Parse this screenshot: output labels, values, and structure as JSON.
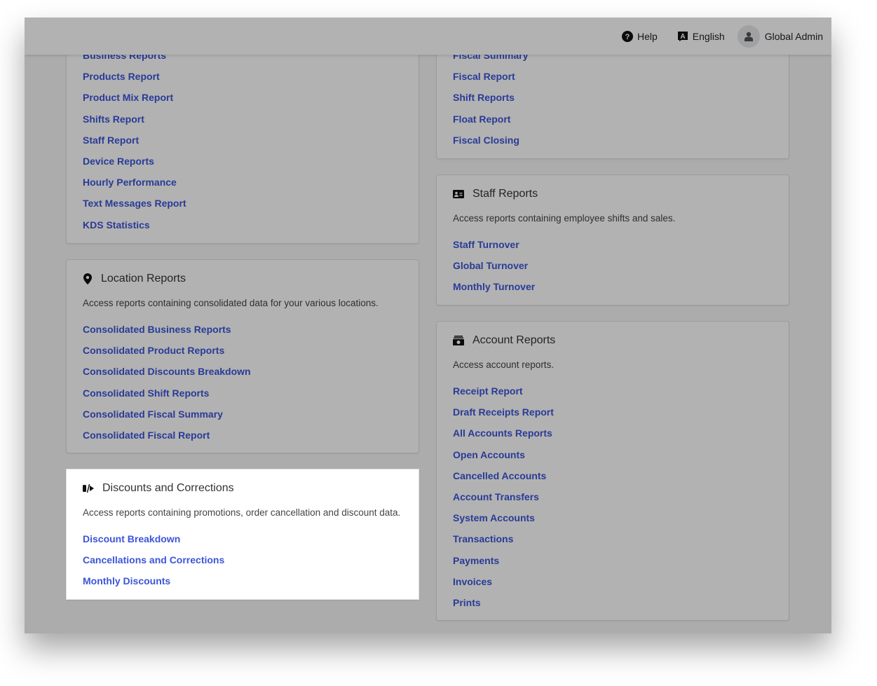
{
  "header": {
    "help": "Help",
    "language": "English",
    "user": "Global Admin"
  },
  "left_cards": {
    "business": {
      "links": [
        "Business Reports",
        "Products Report",
        "Product Mix Report",
        "Shifts Report",
        "Staff Report",
        "Device Reports",
        "Hourly Performance",
        "Text Messages Report",
        "KDS Statistics"
      ]
    },
    "location": {
      "icon": "map-pin-icon",
      "title": "Location Reports",
      "description": "Access reports containing consolidated data for your various locations.",
      "links": [
        "Consolidated Business Reports",
        "Consolidated Product Reports",
        "Consolidated Discounts Breakdown",
        "Consolidated Shift Reports",
        "Consolidated Fiscal Summary",
        "Consolidated Fiscal Report"
      ]
    },
    "discounts": {
      "icon": "discount-tag-icon",
      "title": "Discounts and Corrections",
      "description": "Access reports containing promotions, order cancellation and discount data.",
      "links": [
        "Discount Breakdown",
        "Cancellations and Corrections",
        "Monthly Discounts"
      ],
      "highlighted": true
    }
  },
  "right_cards": {
    "fiscal": {
      "links": [
        "Fiscal Summary",
        "Fiscal Report",
        "Shift Reports",
        "Float Report",
        "Fiscal Closing"
      ]
    },
    "staff": {
      "icon": "id-card-icon",
      "title": "Staff Reports",
      "description": "Access reports containing employee shifts and sales.",
      "links": [
        "Staff Turnover",
        "Global Turnover",
        "Monthly Turnover"
      ]
    },
    "account": {
      "icon": "cash-icon",
      "title": "Account Reports",
      "description": "Access account reports.",
      "links": [
        "Receipt Report",
        "Draft Receipts Report",
        "All Accounts Reports",
        "Open Accounts",
        "Cancelled Accounts",
        "Account Transfers",
        "System Accounts",
        "Transactions",
        "Payments",
        "Invoices",
        "Prints"
      ]
    }
  },
  "colors": {
    "link": "#3b55d9",
    "overlay": "rgba(0,0,0,0.3)"
  }
}
